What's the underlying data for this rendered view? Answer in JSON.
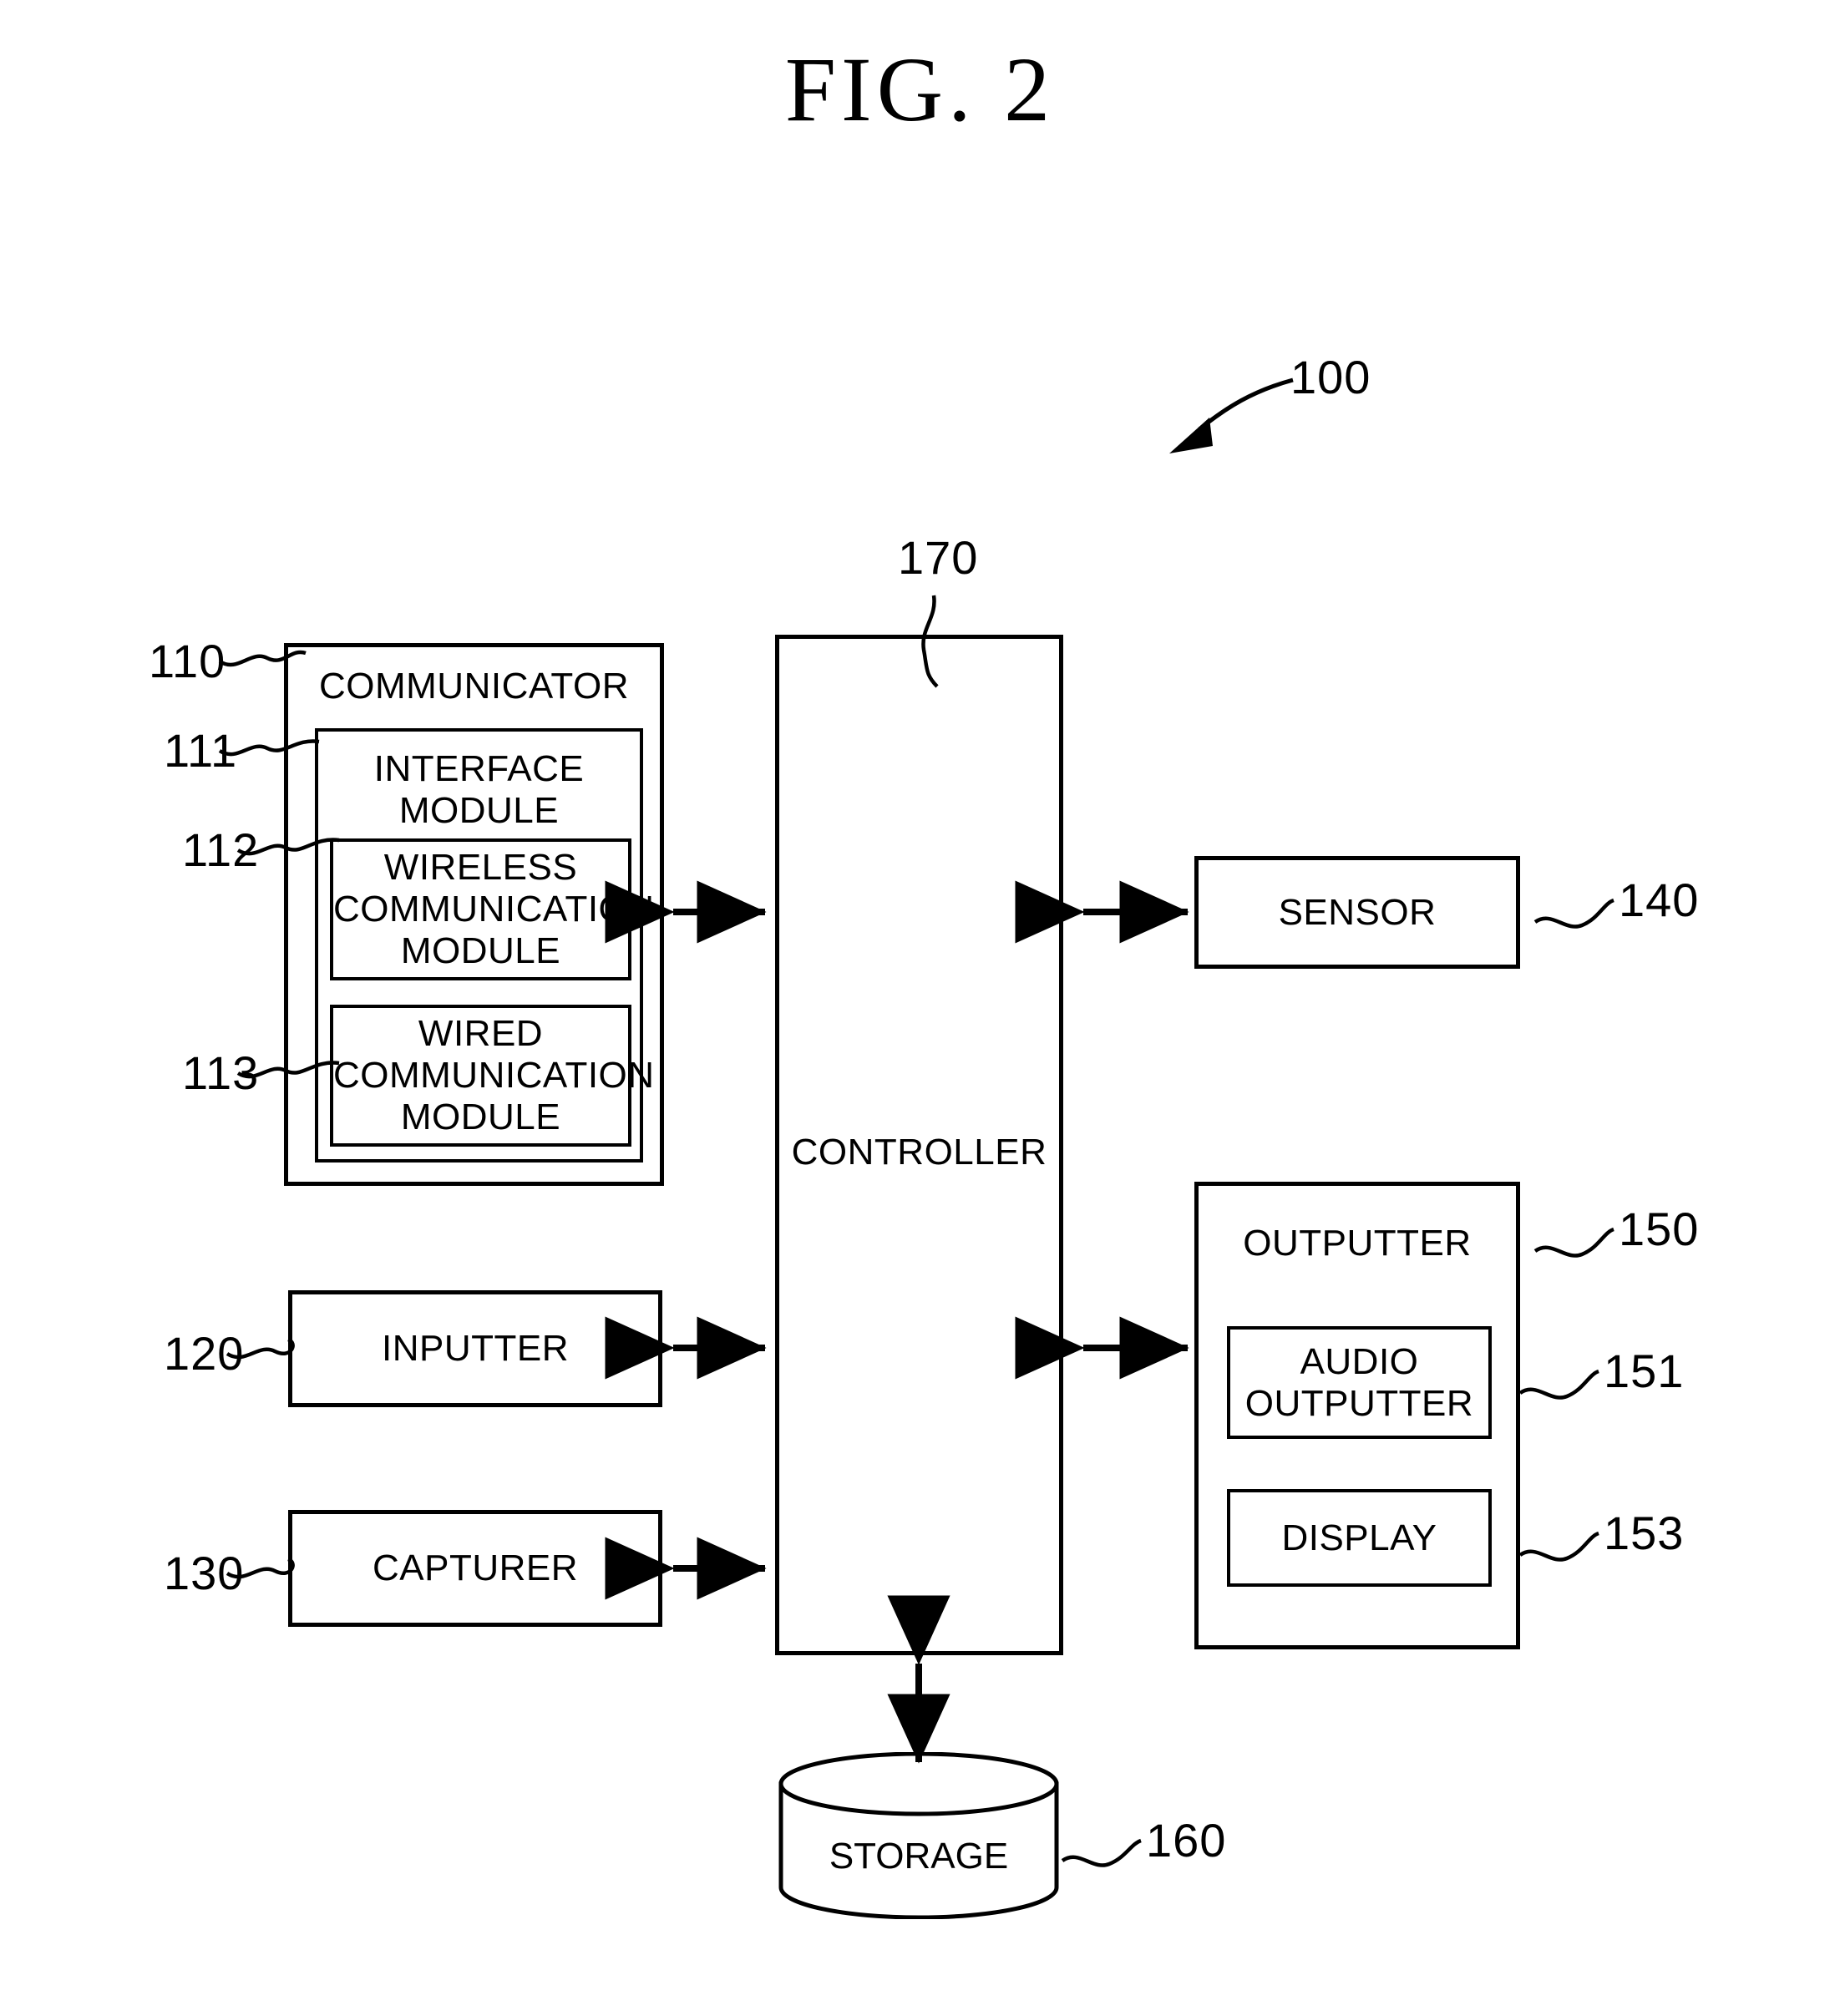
{
  "figure": {
    "title": "FIG. 2",
    "system_ref": "100"
  },
  "blocks": {
    "communicator": {
      "label": "COMMUNICATOR",
      "ref": "110"
    },
    "interface_module": {
      "label": "INTERFACE\nMODULE",
      "ref": "111"
    },
    "wireless_module": {
      "label": "WIRELESS\nCOMMUNICATION\nMODULE",
      "ref": "112"
    },
    "wired_module": {
      "label": "WIRED\nCOMMUNICATION\nMODULE",
      "ref": "113"
    },
    "inputter": {
      "label": "INPUTTER",
      "ref": "120"
    },
    "capturer": {
      "label": "CAPTURER",
      "ref": "130"
    },
    "sensor": {
      "label": "SENSOR",
      "ref": "140"
    },
    "outputter": {
      "label": "OUTPUTTER",
      "ref": "150"
    },
    "audio_outputter": {
      "label": "AUDIO\nOUTPUTTER",
      "ref": "151"
    },
    "display": {
      "label": "DISPLAY",
      "ref": "153"
    },
    "storage": {
      "label": "STORAGE",
      "ref": "160"
    },
    "controller": {
      "label": "CONTROLLER",
      "ref": "170"
    }
  },
  "colors": {
    "ink": "#000000",
    "paper": "#ffffff"
  }
}
